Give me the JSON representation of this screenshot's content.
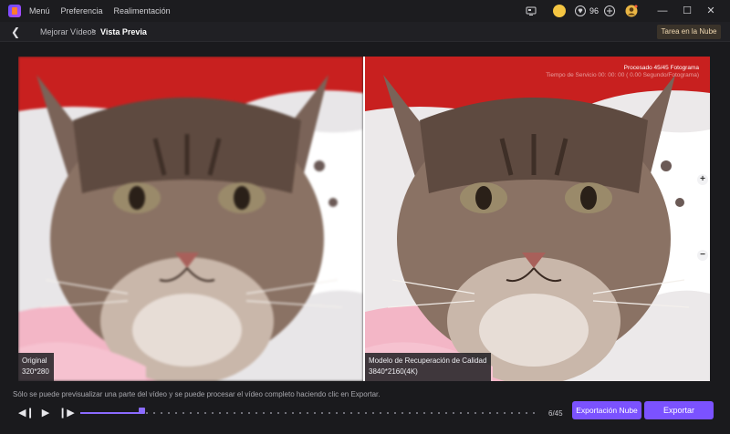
{
  "menu": {
    "items": [
      "Menú",
      "Preferencia",
      "Realimentación"
    ]
  },
  "header": {
    "credits": "96"
  },
  "breadcrumb": {
    "parent": "Mejorar Vídeos",
    "separator": ">",
    "current": "Vista Previa"
  },
  "cloud_task_label": "Tarea en la Nube",
  "preview": {
    "left": {
      "title": "Original",
      "resolution": "320*280"
    },
    "right": {
      "title": "Modelo de Recuperación de Calidad",
      "resolution": "3840*2160(4K)"
    },
    "stats_line1": "Procesado 45/45 Fotograma",
    "stats_line2": "Tiempo de Servicio 00: 00: 00 ( 0.00 Segundo/Fotograma)"
  },
  "zoom": {
    "plus": "+",
    "minus": "−"
  },
  "notice": "Sólo se puede previsualizar una parte del vídeo y se puede procesar el vídeo completo haciendo clic en Exportar.",
  "playback": {
    "current_frame": 6,
    "total_frames": 45,
    "frame_label": "6/45"
  },
  "buttons": {
    "cloud_export": "Exportación Nube",
    "export": "Exportar"
  },
  "colors": {
    "accent": "#7b52ff",
    "background": "#1a1a1d"
  }
}
